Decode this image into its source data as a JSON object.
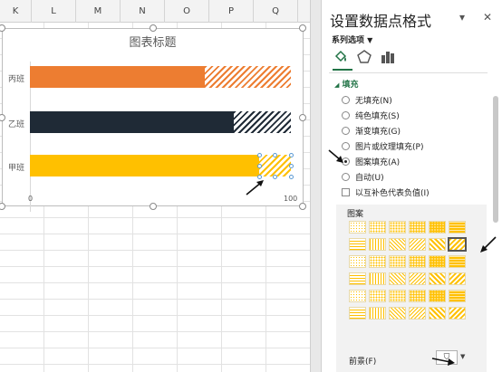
{
  "sheet": {
    "columns": [
      {
        "name": "K",
        "width": 35
      },
      {
        "name": "L",
        "width": 49
      },
      {
        "name": "M",
        "width": 49
      },
      {
        "name": "N",
        "width": 49
      },
      {
        "name": "O",
        "width": 49
      },
      {
        "name": "P",
        "width": 49
      },
      {
        "name": "Q",
        "width": 49
      }
    ]
  },
  "chart_data": {
    "type": "bar",
    "title": "图表标题",
    "categories": [
      "丙班",
      "乙班",
      "甲班"
    ],
    "series": [
      {
        "values": [
          67,
          78,
          88
        ],
        "colors": [
          "#ed7d31",
          "#1f2a36",
          "#ffc000"
        ]
      },
      {
        "values": [
          33,
          22,
          12
        ],
        "fill": "pattern"
      }
    ],
    "xlim": [
      0,
      100
    ],
    "ticks": [
      0,
      100
    ],
    "stacked": true
  },
  "pane": {
    "title": "设置数据点格式",
    "series_options": "系列选项",
    "tabs": [
      "fill-line-icon",
      "effects-icon",
      "series-options-icon"
    ],
    "section": "填充",
    "fill_options": [
      {
        "label": "无填充(N)",
        "selected": false
      },
      {
        "label": "纯色填充(S)",
        "selected": false
      },
      {
        "label": "渐变填充(G)",
        "selected": false
      },
      {
        "label": "图片或纹理填充(P)",
        "selected": false
      },
      {
        "label": "图案填充(A)",
        "selected": true
      },
      {
        "label": "自动(U)",
        "selected": false
      }
    ],
    "invert_label": "以互补色代表负值(I)",
    "pattern_label": "图案",
    "foreground_label": "前景(F)",
    "accent": "#217346",
    "pattern_color": "#ffc000"
  }
}
